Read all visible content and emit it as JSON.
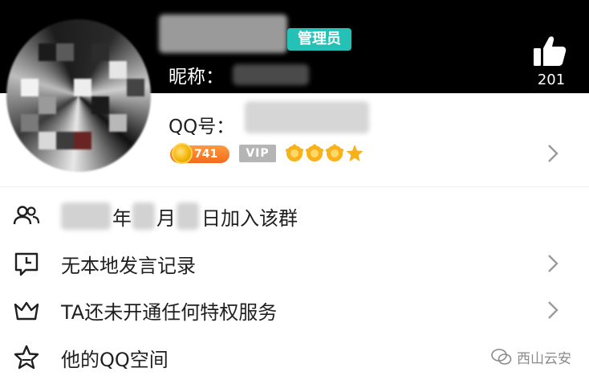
{
  "header": {
    "admin_badge": "管理员",
    "nickname_label": "昵称：",
    "like_count": "201"
  },
  "profile": {
    "qq_label": "QQ号：",
    "level_value": "741",
    "vip_label": "VIP",
    "level_icons": [
      "crown-level-icon",
      "crown-level-icon",
      "crown-level-icon",
      "star-level-icon"
    ]
  },
  "list": {
    "join_year": "年",
    "join_month": "月",
    "join_day_suffix": "日加入该群",
    "speech_record": "无本地发言记录",
    "privilege_service": "TA还未开通任何特权服务",
    "qzone": "他的QQ空间"
  },
  "watermark": {
    "text": "西山云安"
  },
  "colors": {
    "header_bg": "#000000",
    "admin_badge": "#25c1b6",
    "level_badge": "#f26b1d",
    "vip_badge": "#b5b5b5"
  }
}
